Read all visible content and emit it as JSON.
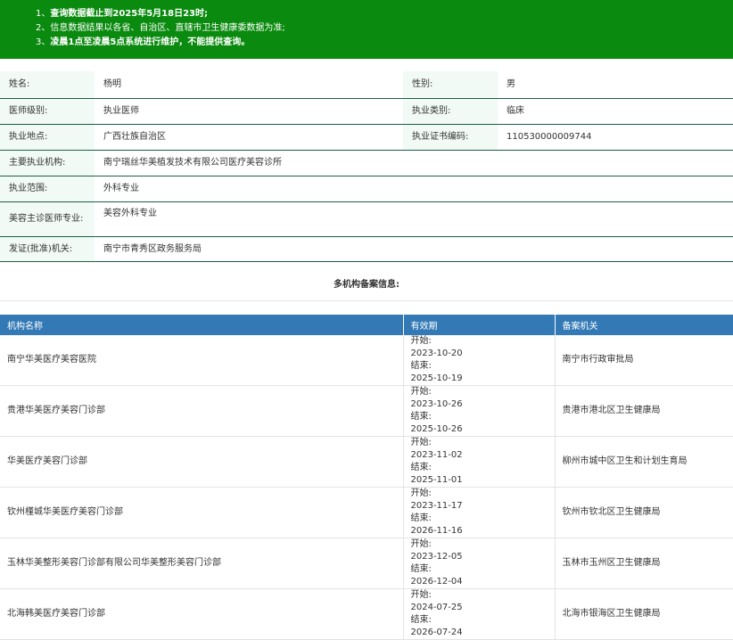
{
  "notice": {
    "lines": [
      {
        "num": "1、",
        "text": "查询数据截止到2025年5月18日23时;",
        "bold": true
      },
      {
        "num": "2、",
        "text": "信息数据结果以各省、自治区、直辖市卫生健康委数据为准;",
        "bold": false
      },
      {
        "num": "3、",
        "text": "凌晨1点至凌晨5点系统进行维护，不能提供查询。",
        "bold": true
      }
    ]
  },
  "doctor": {
    "name_label": "姓名:",
    "name": "杨明",
    "gender_label": "性别:",
    "gender": "男",
    "level_label": "医师级别:",
    "level": "执业医师",
    "category_label": "执业类别:",
    "category": "临床",
    "location_label": "执业地点:",
    "location": "广西壮族自治区",
    "cert_label": "执业证书编码:",
    "cert": "110530000009744",
    "org_label": "主要执业机构:",
    "org": "南宁瑞丝华美植发技术有限公司医疗美容诊所",
    "scope_label": "执业范围:",
    "scope": "外科专业",
    "cosmetic_label": "美容主诊医师专业:",
    "cosmetic": "美容外科专业",
    "issuer_label": "发证(批准)机关:",
    "issuer": "南宁市青秀区政务服务局"
  },
  "filing": {
    "title": "多机构备案信息:",
    "headers": {
      "org": "机构名称",
      "validity": "有效期",
      "authority": "备案机关"
    },
    "start_prefix": "开始:",
    "end_prefix": "结束:",
    "rows": [
      {
        "org": "南宁华美医疗美容医院",
        "start": "2023-10-20",
        "end": "2025-10-19",
        "authority": "南宁市行政审批局"
      },
      {
        "org": "贵港华美医疗美容门诊部",
        "start": "2023-10-26",
        "end": "2025-10-26",
        "authority": "贵港市港北区卫生健康局"
      },
      {
        "org": "华美医疗美容门诊部",
        "start": "2023-11-02",
        "end": "2025-11-01",
        "authority": "柳州市城中区卫生和计划生育局"
      },
      {
        "org": "钦州槿城华美医疗美容门诊部",
        "start": "2023-11-17",
        "end": "2026-11-16",
        "authority": "钦州市钦北区卫生健康局"
      },
      {
        "org": "玉林华美整形美容门诊部有限公司华美整形美容门诊部",
        "start": "2023-12-05",
        "end": "2026-12-04",
        "authority": "玉林市玉州区卫生健康局"
      },
      {
        "org": "北海韩美医疗美容门诊部",
        "start": "2024-07-25",
        "end": "2026-07-24",
        "authority": "北海市银海区卫生健康局"
      }
    ]
  }
}
